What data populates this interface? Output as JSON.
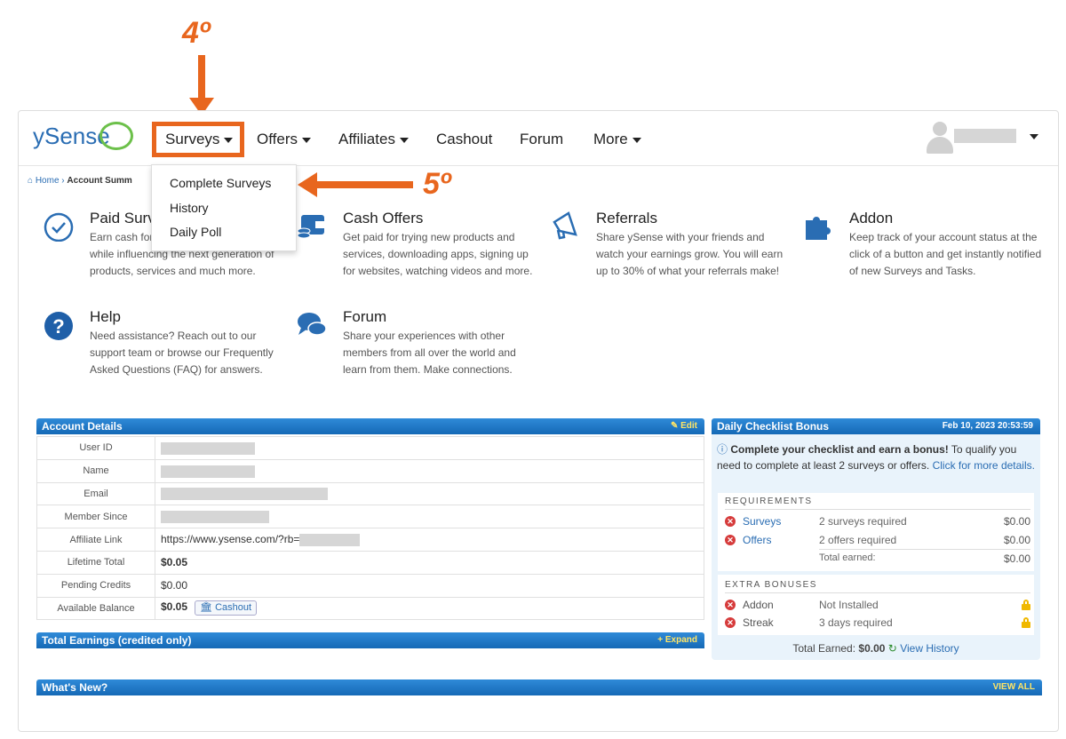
{
  "annotations": {
    "step4": "4º",
    "step5": "5º"
  },
  "logo": "ySense",
  "nav": {
    "surveys": "Surveys",
    "offers": "Offers",
    "affiliates": "Affiliates",
    "cashout": "Cashout",
    "forum": "Forum",
    "more": "More"
  },
  "dropdown": {
    "items": [
      "Complete Surveys",
      "History",
      "Daily Poll"
    ]
  },
  "breadcrumb": {
    "home": "Home",
    "current": "Account Summ"
  },
  "features": [
    {
      "title": "Paid Surveys",
      "text": "Earn cash for sharing your opinions while influencing the next generation of products, services and much more."
    },
    {
      "title": "Cash Offers",
      "text": "Get paid for trying new products and services, downloading apps, signing up for websites, watching videos and more."
    },
    {
      "title": "Referrals",
      "text": "Share ySense with your friends and watch your earnings grow. You will earn up to 30% of what your referrals make!"
    },
    {
      "title": "Addon",
      "text": "Keep track of your account status at the click of a button and get instantly notified of new Surveys and Tasks."
    },
    {
      "title": "Help",
      "text": "Need assistance? Reach out to our support team or browse our Frequently Asked Questions (FAQ) for answers."
    },
    {
      "title": "Forum",
      "text": "Share your experiences with other members from all over the world and learn from them. Make connections."
    }
  ],
  "account": {
    "title": "Account Details",
    "edit": "Edit",
    "rows": [
      {
        "label": "User ID",
        "value": ""
      },
      {
        "label": "Name",
        "value": ""
      },
      {
        "label": "Email",
        "value": ""
      },
      {
        "label": "Member Since",
        "value": ""
      },
      {
        "label": "Affiliate Link",
        "value": "https://www.ysense.com/?rb="
      },
      {
        "label": "Lifetime Total",
        "value": "$0.05"
      },
      {
        "label": "Pending Credits",
        "value": "$0.00"
      },
      {
        "label": "Available Balance",
        "value": "$0.05"
      }
    ],
    "cashout_button": "Cashout"
  },
  "total_earnings": {
    "title": "Total Earnings (credited only)",
    "expand": "Expand"
  },
  "whats_new": {
    "title": "What's New?",
    "view_all": "VIEW ALL"
  },
  "checklist": {
    "title": "Daily Checklist Bonus",
    "datetime": "Feb 10, 2023 20:53:59",
    "intro_bold": "Complete your checklist and earn a bonus!",
    "intro_rest": "To qualify you need to complete at least 2 surveys or offers.",
    "intro_link": "Click for more details.",
    "requirements_label": "REQUIREMENTS",
    "requirements": [
      {
        "name": "Surveys",
        "desc": "2 surveys required",
        "amount": "$0.00"
      },
      {
        "name": "Offers",
        "desc": "2 offers required",
        "amount": "$0.00"
      }
    ],
    "total_earned_label": "Total earned:",
    "total_earned_value": "$0.00",
    "extra_label": "EXTRA BONUSES",
    "extras": [
      {
        "name": "Addon",
        "desc": "Not Installed"
      },
      {
        "name": "Streak",
        "desc": "3 days required"
      }
    ],
    "footer_label": "Total Earned:",
    "footer_value": "$0.00",
    "view_history": "View History"
  },
  "colors": {
    "accent": "#e8661e",
    "header_blue": "#1f7bc8",
    "link": "#2a6db3",
    "logo_green": "#6cc04a"
  }
}
